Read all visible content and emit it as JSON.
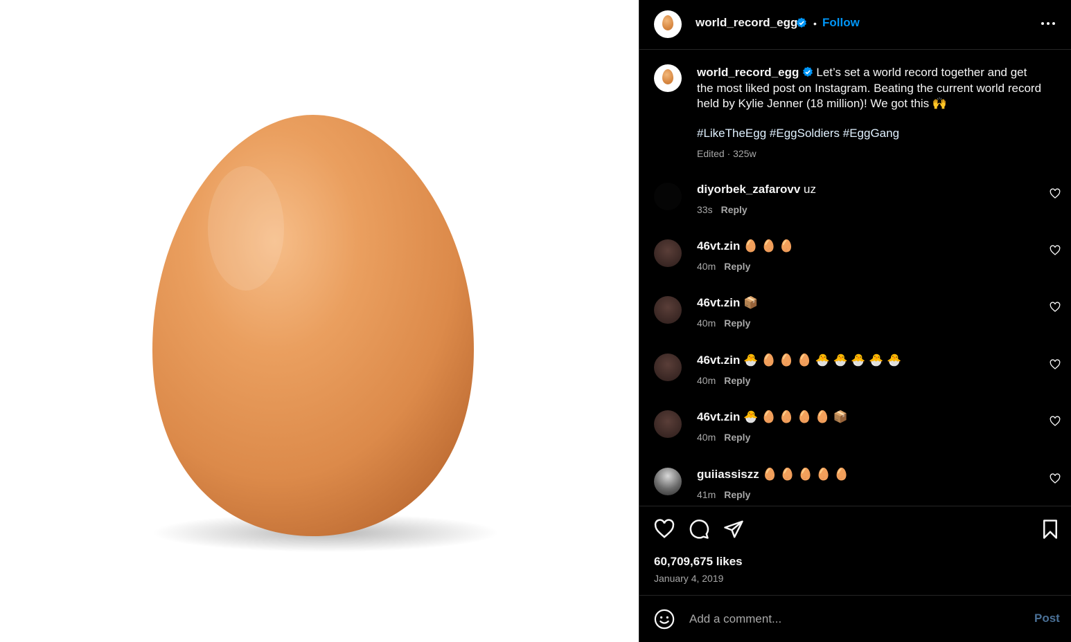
{
  "post": {
    "username": "world_record_egg",
    "follow_label": "Follow",
    "separator": "•",
    "caption": "Let’s set a world record together and get the most liked post on Instagram. Beating the current world record held by Kylie Jenner (18 million)! We got this 🙌",
    "hashtags": "#LikeTheEgg #EggSoldiers #EggGang",
    "edited": "Edited · 325w",
    "likes": "60,709,675 likes",
    "date": "January 4, 2019"
  },
  "comments": [
    {
      "user": "diyorbek_zafarovv",
      "text": "uz",
      "time": "33s",
      "reply": "Reply"
    },
    {
      "user": "46vt.zin",
      "text": "🥚 🥚 🥚",
      "time": "40m",
      "reply": "Reply"
    },
    {
      "user": "46vt.zin",
      "text": "📦",
      "time": "40m",
      "reply": "Reply"
    },
    {
      "user": "46vt.zin",
      "text": "🐣 🥚 🥚 🥚 🐣 🐣 🐣 🐣 🐣",
      "time": "40m",
      "reply": "Reply"
    },
    {
      "user": "46vt.zin",
      "text": "🐣 🥚 🥚 🥚 🥚 📦",
      "time": "40m",
      "reply": "Reply"
    },
    {
      "user": "guiiassiszz",
      "text": "🥚 🥚 🥚 🥚 🥚",
      "time": "41m",
      "reply": "Reply"
    }
  ],
  "composer": {
    "placeholder": "Add a comment...",
    "post_label": "Post"
  },
  "icons": {
    "verified": "verified-badge-icon",
    "more": "more-options-icon",
    "like": "heart-icon",
    "comment": "comment-icon",
    "share": "share-icon",
    "save": "bookmark-icon",
    "emoji": "emoji-icon"
  },
  "colors": {
    "background": "#000000",
    "link_blue": "#0095f6",
    "muted": "#a8a8a8",
    "verified": "#0095f6",
    "egg": "#e3995a"
  }
}
